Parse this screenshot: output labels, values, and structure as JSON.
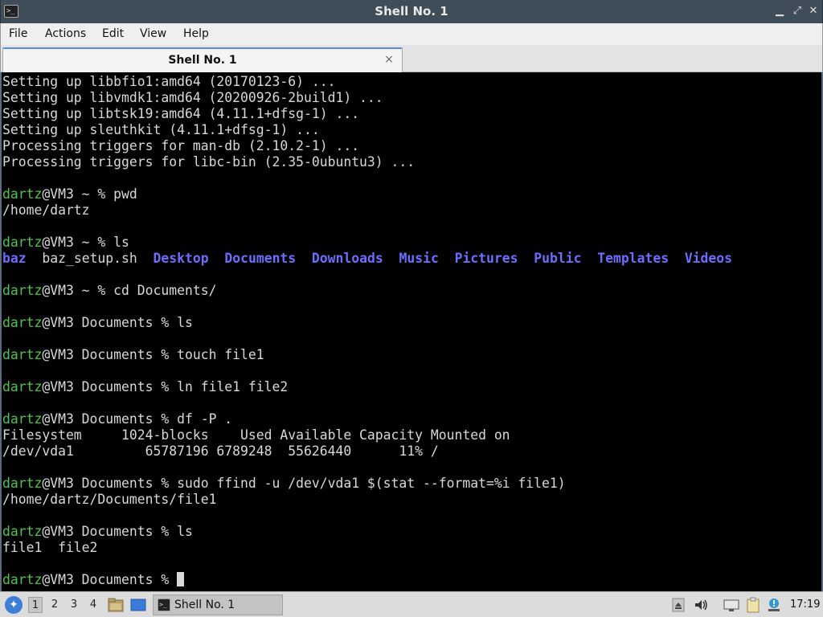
{
  "window": {
    "title": "Shell No. 1"
  },
  "menu": {
    "items": [
      "File",
      "Actions",
      "Edit",
      "View",
      "Help"
    ]
  },
  "tab": {
    "label": "Shell No. 1",
    "close_glyph": "×"
  },
  "terminal": {
    "colors": {
      "prompt_user": "#4ec44e",
      "directory": "#6d6dff",
      "text": "#d8d8d8",
      "background": "#000000"
    },
    "lines": [
      "Setting up libbfio1:amd64 (20170123-6) ...",
      "Setting up libvmdk1:amd64 (20200926-2build1) ...",
      "Setting up libtsk19:amd64 (4.11.1+dfsg-1) ...",
      "Setting up sleuthkit (4.11.1+dfsg-1) ...",
      "Processing triggers for man-db (2.10.2-1) ...",
      "Processing triggers for libc-bin (2.35-0ubuntu3) ...",
      "",
      "@dartz|@VM3 ~ % pwd",
      "/home/dartz",
      "",
      "@dartz|@VM3 ~ % ls",
      "#LS",
      "",
      "@dartz|@VM3 ~ % cd Documents/",
      "",
      "@dartz|@VM3 Documents % ls",
      "",
      "@dartz|@VM3 Documents % touch file1",
      "",
      "@dartz|@VM3 Documents % ln file1 file2",
      "",
      "@dartz|@VM3 Documents % df -P .",
      "Filesystem     1024-blocks    Used Available Capacity Mounted on",
      "/dev/vda1         65787196 6789248  55626440      11% /",
      "",
      "@dartz|@VM3 Documents % sudo ffind -u /dev/vda1 $(stat --format=%i file1)",
      "/home/dartz/Documents/file1",
      "",
      "@dartz|@VM3 Documents % ls",
      "file1  file2",
      "",
      "@dartz|@VM3 Documents % #CURSOR"
    ],
    "ls_home": [
      {
        "name": "baz",
        "type": "dir"
      },
      {
        "name": "baz_setup.sh",
        "type": "file"
      },
      {
        "name": "Desktop",
        "type": "dir"
      },
      {
        "name": "Documents",
        "type": "dir"
      },
      {
        "name": "Downloads",
        "type": "dir"
      },
      {
        "name": "Music",
        "type": "dir"
      },
      {
        "name": "Pictures",
        "type": "dir"
      },
      {
        "name": "Public",
        "type": "dir"
      },
      {
        "name": "Templates",
        "type": "dir"
      },
      {
        "name": "Videos",
        "type": "dir"
      }
    ]
  },
  "taskbar": {
    "workspaces": [
      "1",
      "2",
      "3",
      "4"
    ],
    "active_workspace": "1",
    "task_label": "Shell No. 1",
    "clock": "17:19"
  }
}
